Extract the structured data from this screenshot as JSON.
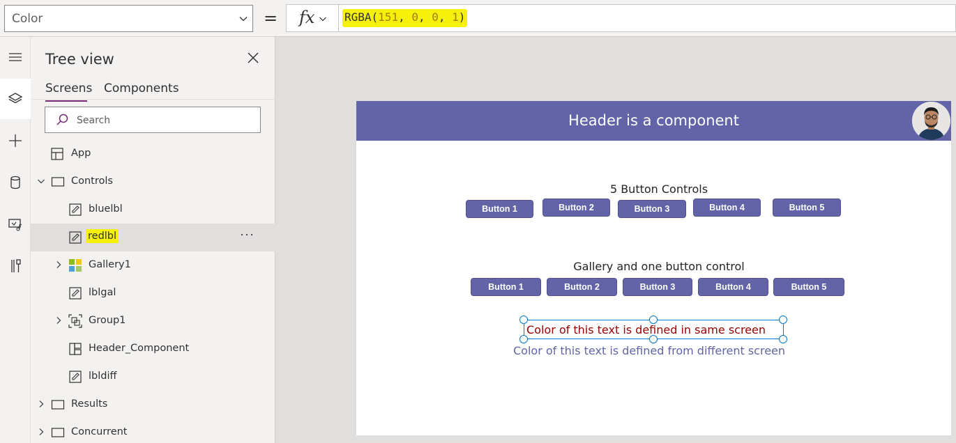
{
  "formula_bar": {
    "property": "Color",
    "equals": "=",
    "fx_label": "fx",
    "formula": {
      "fn": "RGBA(",
      "a": "151",
      "sep1": ", ",
      "b": "0",
      "sep2": ", ",
      "c": "0",
      "sep3": ", ",
      "d": "1",
      "close": ")"
    },
    "highlight_color": "#f5f10a"
  },
  "left_rail": {
    "items": [
      {
        "icon": "hamburger-menu-icon"
      },
      {
        "icon": "layers-icon",
        "active": true
      },
      {
        "icon": "plus-icon"
      },
      {
        "icon": "database-icon"
      },
      {
        "icon": "media-icon"
      },
      {
        "icon": "tools-icon"
      }
    ]
  },
  "tree_view": {
    "title": "Tree view",
    "tabs": [
      "Screens",
      "Components"
    ],
    "active_tab": "Screens",
    "search_placeholder": "Search",
    "items": [
      {
        "label": "App",
        "icon": "app-icon",
        "level": 0,
        "expander": "none"
      },
      {
        "label": "Controls",
        "icon": "screen-icon",
        "level": 0,
        "expander": "expanded"
      },
      {
        "label": "bluelbl",
        "icon": "label-edit-icon",
        "level": 1,
        "expander": "none"
      },
      {
        "label": "redlbl",
        "icon": "label-edit-icon",
        "level": 1,
        "expander": "none",
        "selected": true,
        "highlighted": true,
        "more": "···"
      },
      {
        "label": "Gallery1",
        "icon": "gallery-icon",
        "level": 1,
        "expander": "collapsed"
      },
      {
        "label": "lblgal",
        "icon": "label-edit-icon",
        "level": 1,
        "expander": "none"
      },
      {
        "label": "Group1",
        "icon": "group-icon",
        "level": 1,
        "expander": "collapsed"
      },
      {
        "label": "Header_Component",
        "icon": "component-icon",
        "level": 1,
        "expander": "none"
      },
      {
        "label": "lbldiff",
        "icon": "label-edit-icon",
        "level": 1,
        "expander": "none"
      },
      {
        "label": "Results",
        "icon": "screen-icon",
        "level": 0,
        "expander": "collapsed"
      },
      {
        "label": "Concurrent",
        "icon": "screen-icon",
        "level": 0,
        "expander": "collapsed"
      }
    ]
  },
  "canvas": {
    "header_title": "Header is a component",
    "header_color": "#6264a7",
    "section1_title": "5 Button Controls",
    "row1_buttons": [
      "Button 1",
      "Button 2",
      "Button 3",
      "Button 4",
      "Button 5"
    ],
    "section2_title": "Gallery and one button control",
    "row2_buttons": [
      "Button 1",
      "Button 2",
      "Button 3",
      "Button 4",
      "Button 5"
    ],
    "red_label": "Color of this text is defined in same screen",
    "red_label_color": "#970000",
    "blue_label": "Color of this text is defined from different screen",
    "blue_label_color": "#6264a7",
    "selection_color": "#0078d4"
  }
}
